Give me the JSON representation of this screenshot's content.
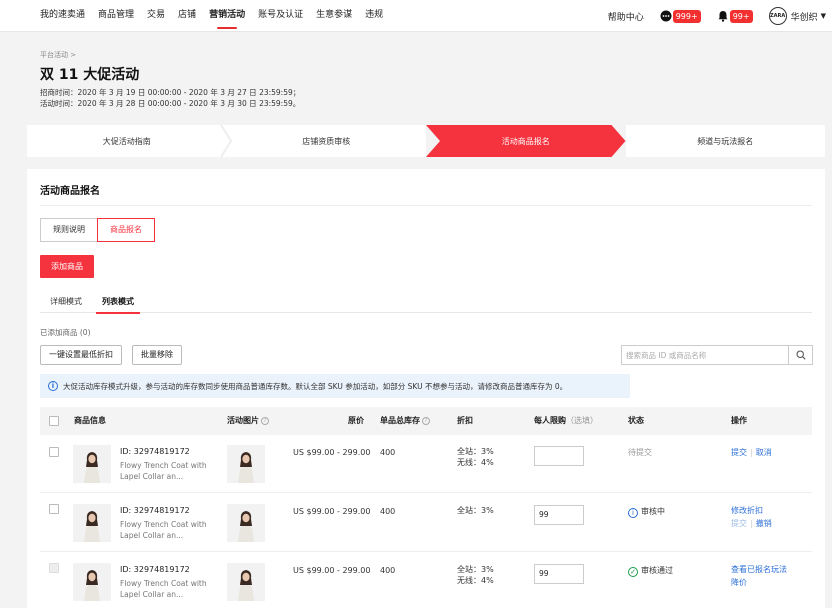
{
  "nav": {
    "items": [
      "我的速卖通",
      "商品管理",
      "交易",
      "店铺",
      "营销活动",
      "账号及认证",
      "生意参谋",
      "违规"
    ],
    "active_index": 4,
    "help": "帮助中心",
    "msg_badge": "999+",
    "bell_badge": "99+",
    "avatar_text": "ZARA",
    "user": "华创织",
    "icons": [
      "chat-icon",
      "bell-icon",
      "chevron-down-icon"
    ]
  },
  "header": {
    "breadcrumb": "平台活动 >",
    "title": "双 11 大促活动",
    "recruit_time": "招商时间：2020 年 3 月 19 日 00:00:00 - 2020 年 3 月 27 日 23:59:59；",
    "activity_time": "活动时间：2020 年 3 月 28 日 00:00:00 - 2020 年 3 月 30 日 23:59:59。"
  },
  "steps": {
    "items": [
      "大促活动指南",
      "店铺资质审核",
      "活动商品报名",
      "频道与玩法报名"
    ],
    "active_index": 2
  },
  "card": {
    "title": "活动商品报名",
    "seg": [
      "规则说明",
      "商品报名"
    ],
    "add_button": "添加商品",
    "modes": [
      "详细模式",
      "列表模式"
    ],
    "added_count": "已添加商品 (0)",
    "set_discount": "一键设置最低折扣",
    "batch_remove": "批量移除",
    "search_placeholder": "搜索商品 ID 或商品名称",
    "info": "大促活动库存模式升级，参与活动的库存数同步使用商品普通库存数。默认全部 SKU 参加活动，如部分 SKU 不想参与活动，请修改商品普通库存为 0。"
  },
  "table": {
    "headers": {
      "info": "商品信息",
      "image": "活动图片",
      "price": "原价",
      "stock": "单品总库存",
      "discount": "折扣",
      "limit": "每人限购",
      "limit_hint": "（选填）",
      "status": "状态",
      "action": "操作"
    },
    "rows": [
      {
        "id": "ID: 32974819172",
        "name1": "Flowy Trench Coat with",
        "name2": "Lapel Collar an...",
        "price": "US $99.00 - 299.00",
        "stock": "400",
        "disc1": "全站：3%",
        "disc2": "无线：4%",
        "limit": "",
        "status": "待提交",
        "action1": "提交",
        "action2": "取消"
      },
      {
        "id": "ID: 32974819172",
        "name1": "Flowy Trench Coat with",
        "name2": "Lapel Collar an...",
        "price": "US $99.00 - 299.00",
        "stock": "400",
        "disc1": "全站：3%",
        "disc2": "",
        "limit": "99",
        "status": "审核中",
        "action1": "修改折扣",
        "action2": "提交",
        "action3": "撤销"
      },
      {
        "id": "ID: 32974819172",
        "name1": "Flowy Trench Coat with",
        "name2": "Lapel Collar an...",
        "price": "US $99.00 - 299.00",
        "stock": "400",
        "disc1": "全站：3%",
        "disc2": "无线：4%",
        "limit": "99",
        "status": "审核通过",
        "action1": "查看已报名玩法",
        "action2": "降价"
      }
    ]
  },
  "colors": {
    "accent": "#f5333f",
    "link": "#2b6fd6",
    "success": "#1a9d4b"
  }
}
